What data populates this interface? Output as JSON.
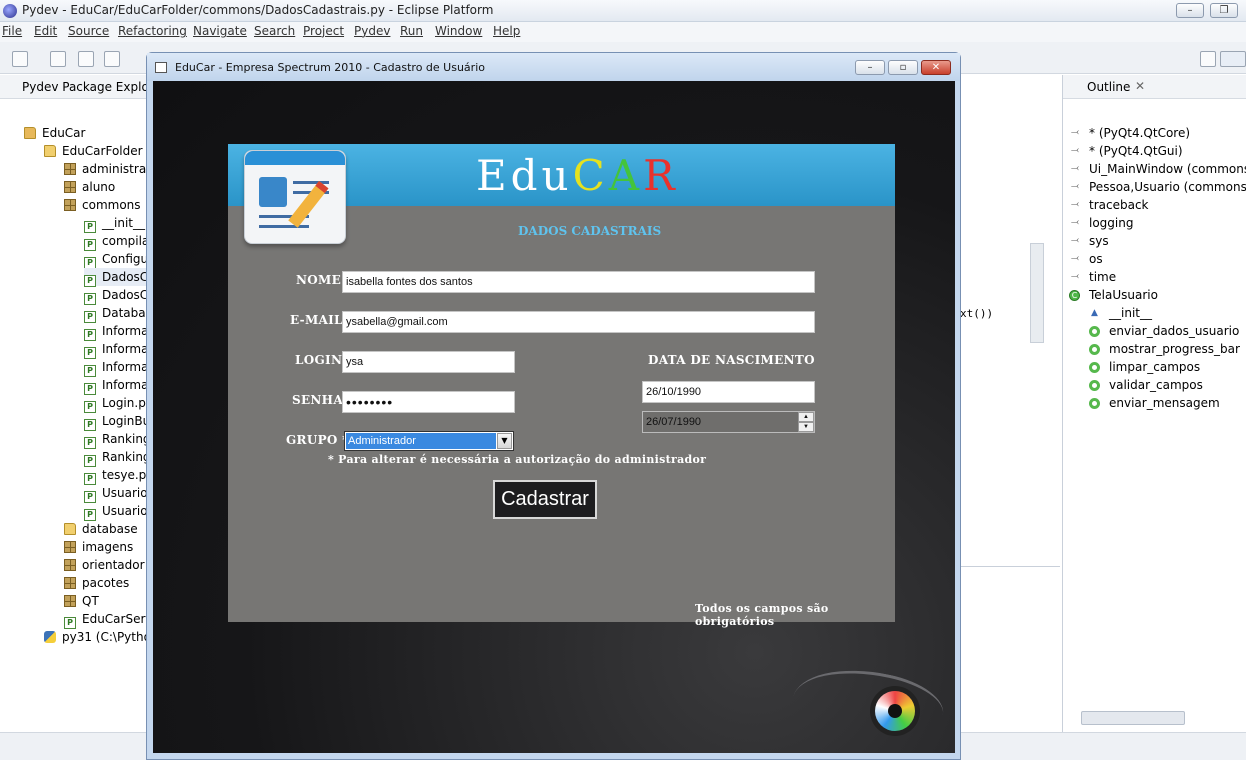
{
  "eclipse": {
    "title": "Pydev - EduCar/EduCarFolder/commons/DadosCadastrais.py - Eclipse Platform",
    "menu": [
      "File",
      "Edit",
      "Source",
      "Refactoring",
      "Navigate",
      "Search",
      "Project",
      "Pydev",
      "Run",
      "Window",
      "Help"
    ],
    "explorer_title": "Pydev Package Explorer",
    "tree": [
      {
        "label": "EduCar",
        "icon": "project-icon"
      },
      {
        "label": "EduCarFolder",
        "icon": "folder-icon"
      },
      {
        "label": "administrad",
        "icon": "package-icon"
      },
      {
        "label": "aluno",
        "icon": "package-icon"
      },
      {
        "label": "commons",
        "icon": "package-icon"
      },
      {
        "label": "__init__.p",
        "icon": "python-file-icon"
      },
      {
        "label": "compila",
        "icon": "python-file-icon"
      },
      {
        "label": "Configu",
        "icon": "python-file-icon"
      },
      {
        "label": "DadosCa",
        "icon": "python-file-icon"
      },
      {
        "label": "DadosCa",
        "icon": "python-file-icon"
      },
      {
        "label": "Databas",
        "icon": "python-file-icon"
      },
      {
        "label": "Informa",
        "icon": "python-file-icon"
      },
      {
        "label": "Informa",
        "icon": "python-file-icon"
      },
      {
        "label": "Informa",
        "icon": "python-file-icon"
      },
      {
        "label": "Informa",
        "icon": "python-file-icon"
      },
      {
        "label": "Login.py",
        "icon": "python-file-icon"
      },
      {
        "label": "LoginBu",
        "icon": "python-file-icon"
      },
      {
        "label": "Ranking",
        "icon": "python-file-icon"
      },
      {
        "label": "Ranking",
        "icon": "python-file-icon"
      },
      {
        "label": "tesye.py",
        "icon": "python-file-icon"
      },
      {
        "label": "UsuarioI",
        "icon": "python-file-icon"
      },
      {
        "label": "Usuarios",
        "icon": "python-file-icon"
      },
      {
        "label": "database",
        "icon": "folder-icon"
      },
      {
        "label": "imagens",
        "icon": "package-icon"
      },
      {
        "label": "orientador",
        "icon": "package-icon"
      },
      {
        "label": "pacotes",
        "icon": "package-icon"
      },
      {
        "label": "QT",
        "icon": "package-icon"
      },
      {
        "label": "EduCarServi",
        "icon": "python-file-icon"
      },
      {
        "label": "py31  (C:\\Pytho",
        "icon": "python-icon"
      }
    ],
    "editor_fragment": "xt())",
    "outline_title": "Outline",
    "outline": [
      {
        "label": "* (PyQt4.QtCore)",
        "kind": "import"
      },
      {
        "label": "* (PyQt4.QtGui)",
        "kind": "import"
      },
      {
        "label": "Ui_MainWindow (commons",
        "kind": "import"
      },
      {
        "label": "Pessoa,Usuario (commons",
        "kind": "import"
      },
      {
        "label": "traceback",
        "kind": "import"
      },
      {
        "label": "logging",
        "kind": "import"
      },
      {
        "label": "sys",
        "kind": "import"
      },
      {
        "label": "os",
        "kind": "import"
      },
      {
        "label": "time",
        "kind": "import"
      },
      {
        "label": "TelaUsuario",
        "kind": "class"
      },
      {
        "label": "__init__",
        "kind": "attr"
      },
      {
        "label": "enviar_dados_usuario",
        "kind": "method"
      },
      {
        "label": "mostrar_progress_bar",
        "kind": "method"
      },
      {
        "label": "limpar_campos",
        "kind": "method"
      },
      {
        "label": "validar_campos",
        "kind": "method"
      },
      {
        "label": "enviar_mensagem",
        "kind": "method"
      }
    ]
  },
  "dialog": {
    "title": "EduCar - Empresa Spectrum 2010 - Cadastro de Usuário",
    "logo": "EduCAR",
    "section": "DADOS CADASTRAIS",
    "labels": {
      "nome": "NOME",
      "email": "E-MAIL",
      "login": "LOGIN",
      "senha": "SENHA",
      "grupo": "GRUPO *",
      "data": "DATA DE NASCIMENTO"
    },
    "values": {
      "nome": "isabella fontes dos santos",
      "email": "ysabella@gmail.com",
      "login": "ysa",
      "senha": "••••••••",
      "grupo": "Administrador",
      "data1": "26/10/1990",
      "data2": "26/07/1990"
    },
    "note": "* Para alterar é necessária a autorização do administrador",
    "submit": "Cadastrar",
    "footer": "Todos os campos são obrigatórios"
  }
}
